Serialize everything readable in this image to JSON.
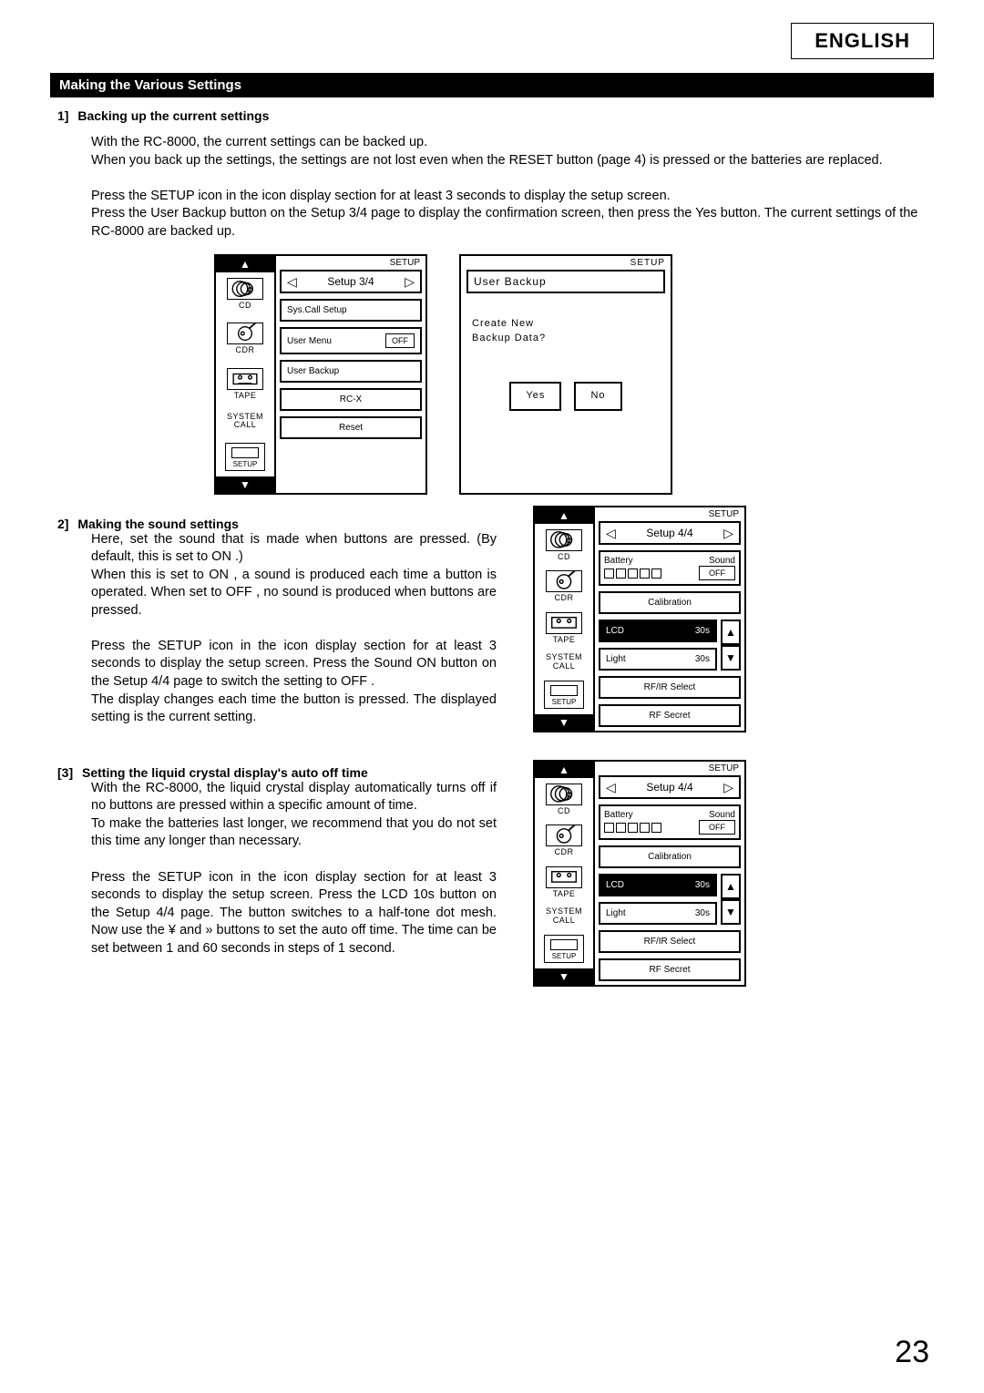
{
  "header": {
    "language_badge": "ENGLISH",
    "section_title": "Making the Various Settings"
  },
  "items": {
    "1": {
      "num": "1]",
      "title": "Backing up the current settings",
      "p1": "With the RC-8000, the current settings can be backed up.",
      "p2": "When you back up the settings, the settings are not lost even when the RESET button (page 4) is pressed or the batteries are replaced.",
      "p3": "Press the  SETUP  icon in the icon display section for at least 3 seconds to display the setup screen.",
      "p4": "Press the  User Backup  button on the  Setup 3/4  page to display the confirmation screen, then press the  Yes  button.  The current settings of the RC-8000 are backed up."
    },
    "2": {
      "num": "2]",
      "title": "Making the sound settings",
      "p1": "Here, set the sound that is made when buttons are pressed. (By default, this is set to  ON .)",
      "p2": "When this is set to  ON , a sound is produced each time a button is operated.  When set to  OFF , no sound is produced when buttons are pressed.",
      "p3": "Press the  SETUP  icon in the icon display section for at least 3 seconds to display the setup screen. Press the  Sound ON  button on the  Setup 4/4  page to switch the setting to  OFF .",
      "p4": "The display changes each time the button is pressed.  The displayed setting is the current setting."
    },
    "3": {
      "num": "[3]",
      "title": "Setting the liquid crystal display's auto off time",
      "p1": "With the RC-8000, the liquid crystal display automatically turns off if no buttons are pressed within a specific amount of time.",
      "p2": "To make the batteries last longer, we recommend that you do not set this time any longer than necessary.",
      "p3": "Press the  SETUP  icon in the icon display section for at least 3 seconds to display the setup screen. Press the  LCD 10s  button on the  Setup 4/4  page.  The button switches to a half-tone dot mesh. Now use the  ¥  and »  buttons to set the auto off time.  The time can be set between 1 and 60 seconds in steps of 1 second."
    }
  },
  "sidebar": {
    "cd": "CD",
    "cdr": "CDR",
    "tape": "TAPE",
    "system_call": "SYSTEM CALL",
    "setup": "SETUP"
  },
  "screen1": {
    "mode": "SETUP",
    "title": "Setup 3/4",
    "buttons": {
      "sys_call": "Sys.Call Setup",
      "user_menu": "User Menu",
      "user_menu_state": "OFF",
      "user_backup": "User Backup",
      "rcx": "RC-X",
      "reset": "Reset"
    }
  },
  "screen2": {
    "mode": "SETUP",
    "title": "User Backup",
    "question1": "Create New",
    "question2": "Backup Data?",
    "yes": "Yes",
    "no": "No"
  },
  "screen3": {
    "mode": "SETUP",
    "title": "Setup 4/4",
    "battery": "Battery",
    "sound": "Sound",
    "sound_state": "OFF",
    "calibration": "Calibration",
    "lcd": "LCD",
    "lcd_val": "30s",
    "light": "Light",
    "light_val": "30s",
    "rfir": "RF/IR Select",
    "rf_secret": "RF Secret"
  },
  "screen4": {
    "mode": "SETUP",
    "title": "Setup 4/4",
    "battery": "Battery",
    "sound": "Sound",
    "sound_state": "OFF",
    "calibration": "Calibration",
    "lcd": "LCD",
    "lcd_val": "30s",
    "light": "Light",
    "light_val": "30s",
    "rfir": "RF/IR Select",
    "rf_secret": "RF Secret"
  },
  "page_number": "23"
}
